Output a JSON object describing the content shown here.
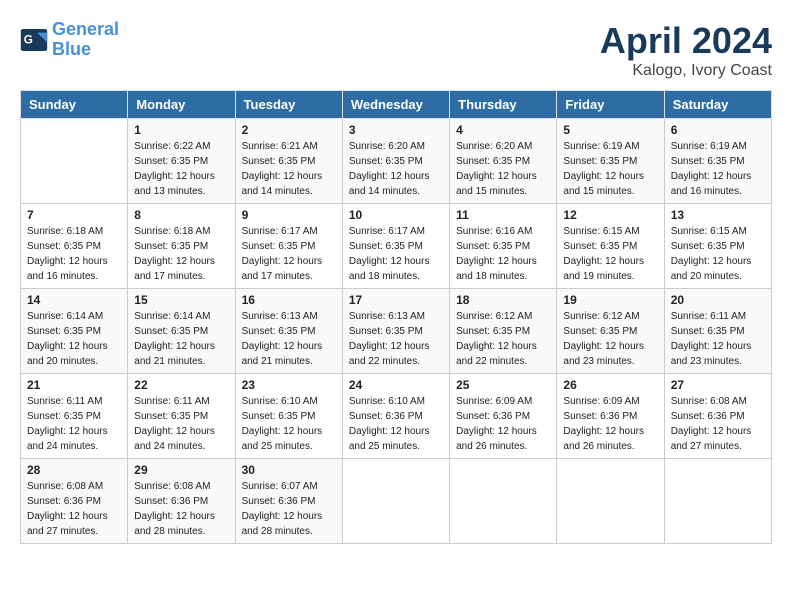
{
  "logo": {
    "line1": "General",
    "line2": "Blue"
  },
  "title": "April 2024",
  "location": "Kalogo, Ivory Coast",
  "weekdays": [
    "Sunday",
    "Monday",
    "Tuesday",
    "Wednesday",
    "Thursday",
    "Friday",
    "Saturday"
  ],
  "weeks": [
    [
      null,
      {
        "day": "1",
        "sunrise": "6:22 AM",
        "sunset": "6:35 PM",
        "daylight": "12 hours and 13 minutes."
      },
      {
        "day": "2",
        "sunrise": "6:21 AM",
        "sunset": "6:35 PM",
        "daylight": "12 hours and 14 minutes."
      },
      {
        "day": "3",
        "sunrise": "6:20 AM",
        "sunset": "6:35 PM",
        "daylight": "12 hours and 14 minutes."
      },
      {
        "day": "4",
        "sunrise": "6:20 AM",
        "sunset": "6:35 PM",
        "daylight": "12 hours and 15 minutes."
      },
      {
        "day": "5",
        "sunrise": "6:19 AM",
        "sunset": "6:35 PM",
        "daylight": "12 hours and 15 minutes."
      },
      {
        "day": "6",
        "sunrise": "6:19 AM",
        "sunset": "6:35 PM",
        "daylight": "12 hours and 16 minutes."
      }
    ],
    [
      {
        "day": "7",
        "sunrise": "6:18 AM",
        "sunset": "6:35 PM",
        "daylight": "12 hours and 16 minutes."
      },
      {
        "day": "8",
        "sunrise": "6:18 AM",
        "sunset": "6:35 PM",
        "daylight": "12 hours and 17 minutes."
      },
      {
        "day": "9",
        "sunrise": "6:17 AM",
        "sunset": "6:35 PM",
        "daylight": "12 hours and 17 minutes."
      },
      {
        "day": "10",
        "sunrise": "6:17 AM",
        "sunset": "6:35 PM",
        "daylight": "12 hours and 18 minutes."
      },
      {
        "day": "11",
        "sunrise": "6:16 AM",
        "sunset": "6:35 PM",
        "daylight": "12 hours and 18 minutes."
      },
      {
        "day": "12",
        "sunrise": "6:15 AM",
        "sunset": "6:35 PM",
        "daylight": "12 hours and 19 minutes."
      },
      {
        "day": "13",
        "sunrise": "6:15 AM",
        "sunset": "6:35 PM",
        "daylight": "12 hours and 20 minutes."
      }
    ],
    [
      {
        "day": "14",
        "sunrise": "6:14 AM",
        "sunset": "6:35 PM",
        "daylight": "12 hours and 20 minutes."
      },
      {
        "day": "15",
        "sunrise": "6:14 AM",
        "sunset": "6:35 PM",
        "daylight": "12 hours and 21 minutes."
      },
      {
        "day": "16",
        "sunrise": "6:13 AM",
        "sunset": "6:35 PM",
        "daylight": "12 hours and 21 minutes."
      },
      {
        "day": "17",
        "sunrise": "6:13 AM",
        "sunset": "6:35 PM",
        "daylight": "12 hours and 22 minutes."
      },
      {
        "day": "18",
        "sunrise": "6:12 AM",
        "sunset": "6:35 PM",
        "daylight": "12 hours and 22 minutes."
      },
      {
        "day": "19",
        "sunrise": "6:12 AM",
        "sunset": "6:35 PM",
        "daylight": "12 hours and 23 minutes."
      },
      {
        "day": "20",
        "sunrise": "6:11 AM",
        "sunset": "6:35 PM",
        "daylight": "12 hours and 23 minutes."
      }
    ],
    [
      {
        "day": "21",
        "sunrise": "6:11 AM",
        "sunset": "6:35 PM",
        "daylight": "12 hours and 24 minutes."
      },
      {
        "day": "22",
        "sunrise": "6:11 AM",
        "sunset": "6:35 PM",
        "daylight": "12 hours and 24 minutes."
      },
      {
        "day": "23",
        "sunrise": "6:10 AM",
        "sunset": "6:35 PM",
        "daylight": "12 hours and 25 minutes."
      },
      {
        "day": "24",
        "sunrise": "6:10 AM",
        "sunset": "6:36 PM",
        "daylight": "12 hours and 25 minutes."
      },
      {
        "day": "25",
        "sunrise": "6:09 AM",
        "sunset": "6:36 PM",
        "daylight": "12 hours and 26 minutes."
      },
      {
        "day": "26",
        "sunrise": "6:09 AM",
        "sunset": "6:36 PM",
        "daylight": "12 hours and 26 minutes."
      },
      {
        "day": "27",
        "sunrise": "6:08 AM",
        "sunset": "6:36 PM",
        "daylight": "12 hours and 27 minutes."
      }
    ],
    [
      {
        "day": "28",
        "sunrise": "6:08 AM",
        "sunset": "6:36 PM",
        "daylight": "12 hours and 27 minutes."
      },
      {
        "day": "29",
        "sunrise": "6:08 AM",
        "sunset": "6:36 PM",
        "daylight": "12 hours and 28 minutes."
      },
      {
        "day": "30",
        "sunrise": "6:07 AM",
        "sunset": "6:36 PM",
        "daylight": "12 hours and 28 minutes."
      },
      null,
      null,
      null,
      null
    ]
  ],
  "labels": {
    "sunrise": "Sunrise:",
    "sunset": "Sunset:",
    "daylight": "Daylight:"
  }
}
